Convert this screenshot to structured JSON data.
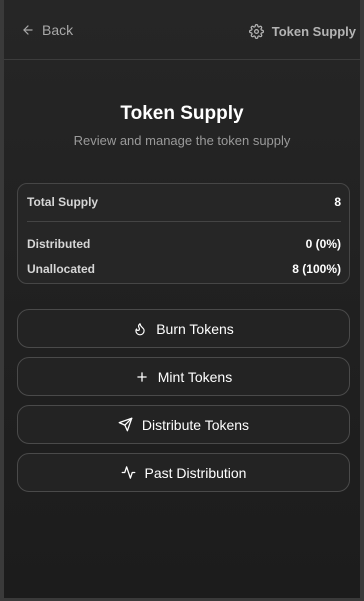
{
  "header": {
    "back_label": "Back",
    "crumb_label": "Token Supply"
  },
  "page": {
    "title": "Token Supply",
    "subtitle": "Review and manage the token supply"
  },
  "supply": {
    "total_label": "Total Supply",
    "total_value": "8",
    "distributed_label": "Distributed",
    "distributed_value": "0 (0%)",
    "unallocated_label": "Unallocated",
    "unallocated_value": "8 (100%)"
  },
  "actions": [
    {
      "label": "Burn Tokens",
      "icon": "flame-icon"
    },
    {
      "label": "Mint Tokens",
      "icon": "plus-icon"
    },
    {
      "label": "Distribute Tokens",
      "icon": "send-icon"
    },
    {
      "label": "Past Distribution",
      "icon": "activity-icon"
    }
  ]
}
